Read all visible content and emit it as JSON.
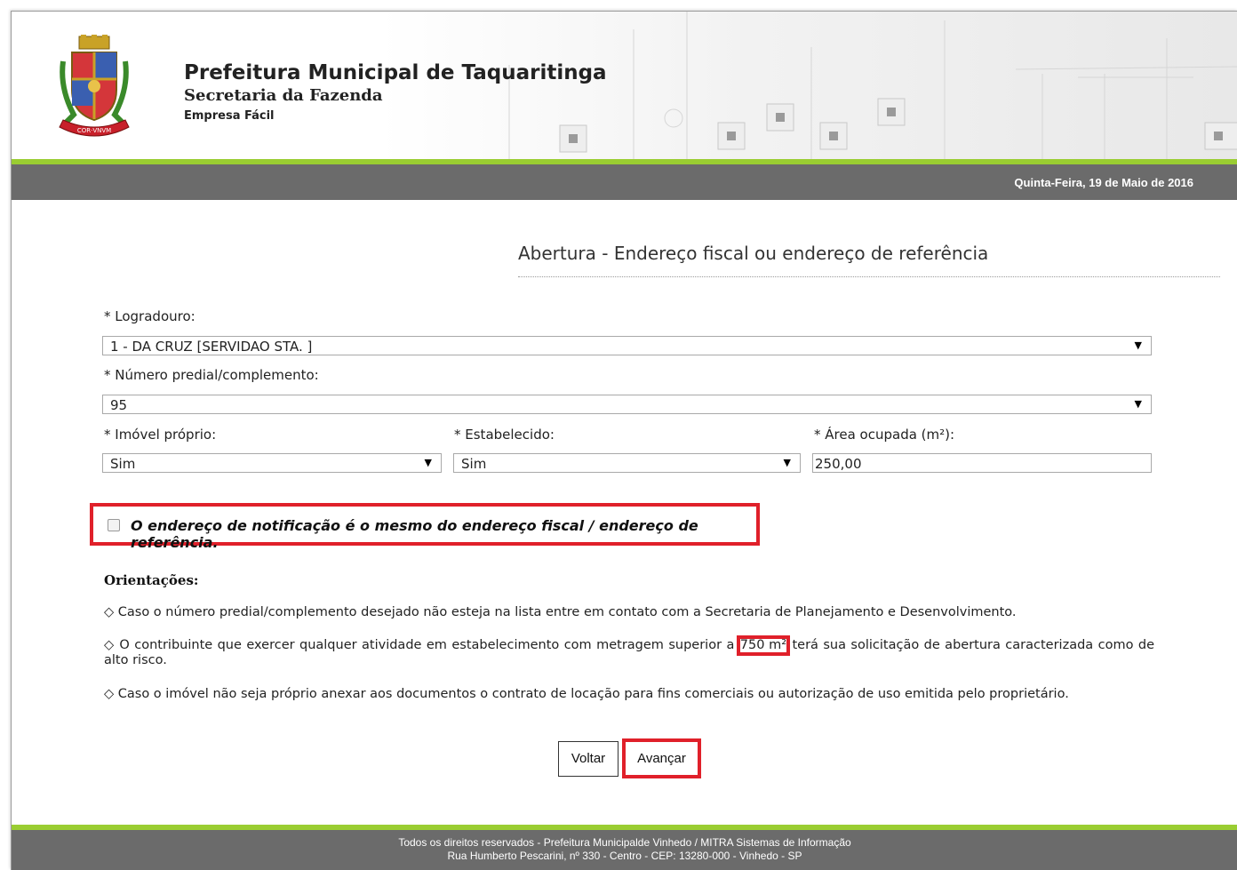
{
  "header": {
    "title": "Prefeitura Municipal de Taquaritinga",
    "subtitle": "Secretaria da Fazenda",
    "subtitle2": "Empresa Fácil",
    "date": "Quinta-Feira, 19 de Maio de 2016"
  },
  "page": {
    "title": "Abertura - Endereço fiscal ou endereço de referência"
  },
  "form": {
    "logradouro_label": "* Logradouro:",
    "logradouro_value": "1 - DA CRUZ [SERVIDAO STA. ]",
    "numero_label": "* Número predial/complemento:",
    "numero_value": "95",
    "imovel_label": "* Imóvel próprio:",
    "imovel_value": "Sim",
    "estabelecido_label": "* Estabelecido:",
    "estabelecido_value": "Sim",
    "area_label": "* Área ocupada (m²):",
    "area_value": "250,00",
    "checkbox_label": "O endereço de notificação é o mesmo do endereço fiscal / endereço de referência.",
    "checkbox_checked": false
  },
  "orientacoes": {
    "heading": "Orientações:",
    "item1": "◇ Caso o número predial/complemento desejado não esteja na lista entre em contato com a Secretaria de Planejamento e Desenvolvimento.",
    "item2_pre": "◇ O contribuinte que exercer qualquer atividade em estabelecimento com metragem superior a",
    "item2_highlight": "750 m²",
    "item2_post": "terá sua solicitação de abertura caracterizada como de alto risco.",
    "item3": "◇ Caso o imóvel não seja próprio anexar aos documentos o contrato de locação para fins comerciais ou autorização de uso emitida pelo proprietário."
  },
  "buttons": {
    "back": "Voltar",
    "next": "Avançar"
  },
  "footer": {
    "line1": "Todos os direitos reservados - Prefeitura Municipalde Vinhedo / MITRA Sistemas de Informação",
    "line2": "Rua Humberto Pescarini, nº 330 - Centro - CEP: 13280-000 - Vinhedo - SP"
  },
  "colors": {
    "accent_green": "#9acd32",
    "bar_gray": "#6b6b6b",
    "highlight_red": "#e0202a"
  },
  "icons": {
    "logo": "coat-of-arms-logo",
    "dropdown": "triangle-down"
  }
}
